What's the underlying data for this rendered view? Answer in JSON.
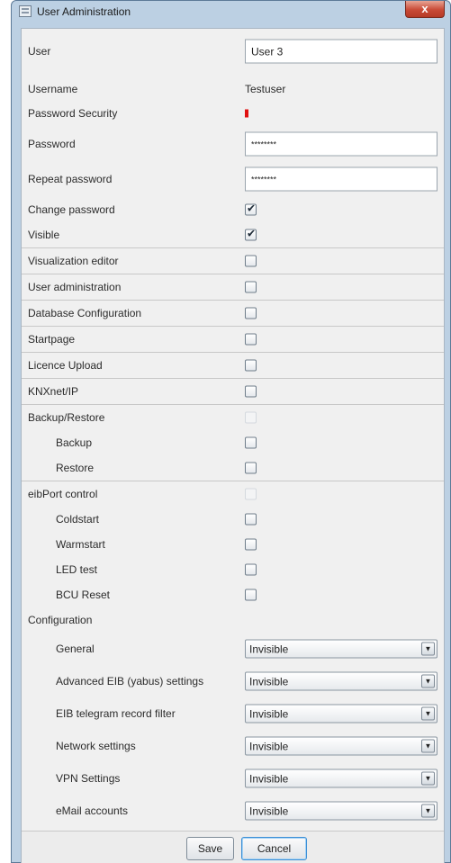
{
  "window": {
    "title": "User Administration",
    "close_glyph": "x",
    "icon": "app-window-icon"
  },
  "user": {
    "label": "User",
    "value": "User 3"
  },
  "username": {
    "label": "Username",
    "value": "Testuser"
  },
  "password_security": {
    "label": "Password Security",
    "strength_color": "#e01010"
  },
  "password": {
    "label": "Password",
    "value": "********"
  },
  "repeat_password": {
    "label": "Repeat password",
    "value": "********"
  },
  "permissions": [
    {
      "label": "Change password",
      "checked": true
    },
    {
      "label": "Visible",
      "checked": true
    },
    {
      "label": "Visualization editor",
      "checked": false
    },
    {
      "label": "User administration",
      "checked": false
    },
    {
      "label": "Database Configuration",
      "checked": false
    },
    {
      "label": "Startpage",
      "checked": false
    },
    {
      "label": "Licence Upload",
      "checked": false
    },
    {
      "label": "KNXnet/IP",
      "checked": false
    }
  ],
  "backup_restore": {
    "label": "Backup/Restore",
    "items": [
      {
        "label": "Backup",
        "checked": false
      },
      {
        "label": "Restore",
        "checked": false
      }
    ]
  },
  "eibport_control": {
    "label": "eibPort control",
    "items": [
      {
        "label": "Coldstart",
        "checked": false
      },
      {
        "label": "Warmstart",
        "checked": false
      },
      {
        "label": "LED test",
        "checked": false
      },
      {
        "label": "BCU Reset",
        "checked": false
      }
    ]
  },
  "configuration": {
    "label": "Configuration",
    "items": [
      {
        "label": "General",
        "value": "Invisible"
      },
      {
        "label": "Advanced EIB (yabus) settings",
        "value": "Invisible"
      },
      {
        "label": "EIB telegram record filter",
        "value": "Invisible"
      },
      {
        "label": "Network settings",
        "value": "Invisible"
      },
      {
        "label": "VPN Settings",
        "value": "Invisible"
      },
      {
        "label": "eMail accounts",
        "value": "Invisible"
      }
    ]
  },
  "buttons": {
    "save": "Save",
    "cancel": "Cancel"
  }
}
